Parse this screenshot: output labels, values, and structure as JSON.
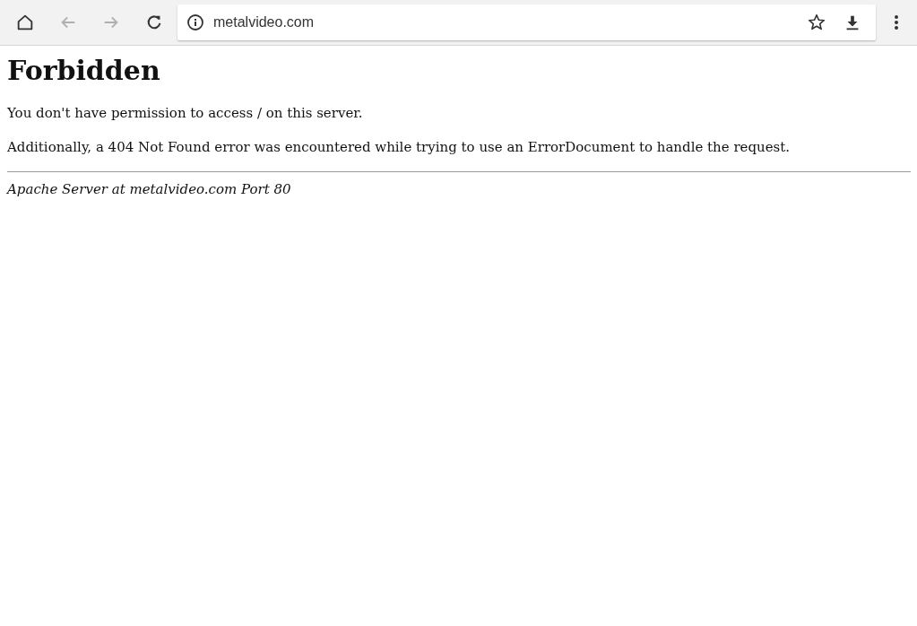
{
  "toolbar": {
    "back": {
      "disabled": true
    },
    "forward": {
      "disabled": true
    },
    "address": "metalvideo.com"
  },
  "page": {
    "heading": "Forbidden",
    "paragraphs": [
      "You don't have permission to access / on this server.",
      "Additionally, a 404 Not Found error was encountered while trying to use an ErrorDocument to handle the request."
    ],
    "footer": "Apache Server at metalvideo.com Port 80"
  }
}
